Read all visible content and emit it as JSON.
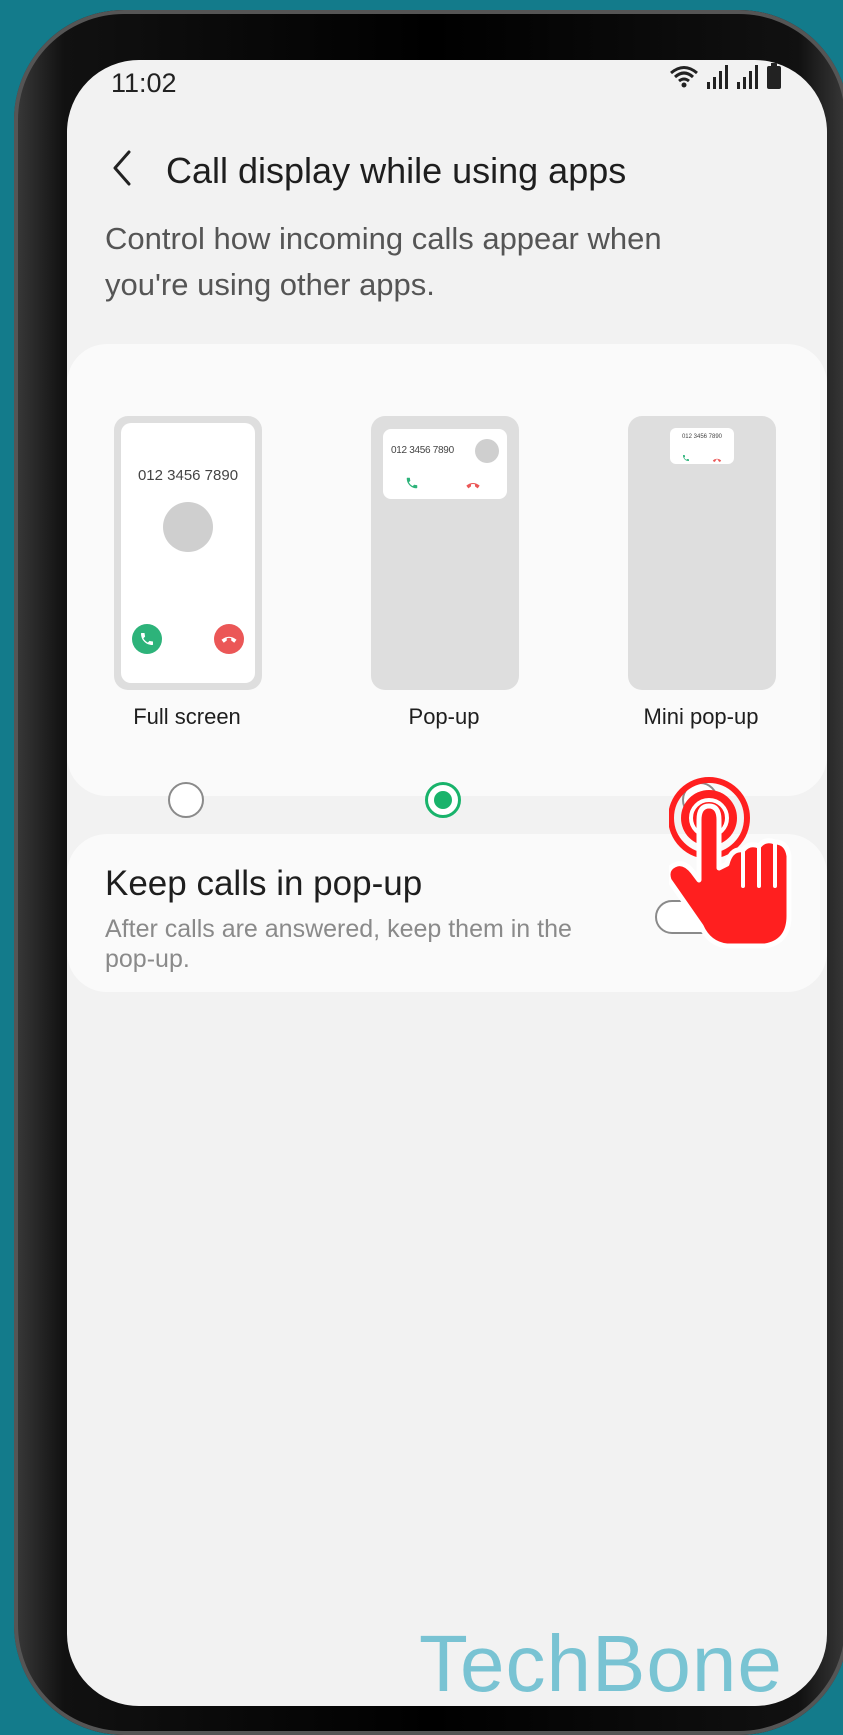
{
  "status_bar": {
    "time": "11:02",
    "icons": [
      "wifi-icon",
      "signal-icon",
      "signal-icon",
      "battery-icon"
    ]
  },
  "header": {
    "back_icon": "chevron-left-icon",
    "title": "Call display while using apps"
  },
  "description": "Control how incoming calls appear when you're using other apps.",
  "call_display": {
    "selected": "Pop-up",
    "options": [
      {
        "label": "Full screen",
        "preview_number": "012 3456 7890",
        "selected": false
      },
      {
        "label": "Pop-up",
        "preview_number": "012 3456 7890",
        "selected": true
      },
      {
        "label": "Mini pop-up",
        "preview_number": "012 3456 7890",
        "selected": false
      }
    ],
    "colors": {
      "accept": "#2db37a",
      "decline": "#eb5757",
      "radio_selected": "#19b36b"
    }
  },
  "keep_calls": {
    "title": "Keep calls in pop-up",
    "subtitle": "After calls are answered, keep them in the pop-up.",
    "enabled": false
  },
  "overlay": {
    "tap_indicator_icon": "tap-hand-icon",
    "color": "#ff1f1f"
  },
  "watermark": "TechBone"
}
